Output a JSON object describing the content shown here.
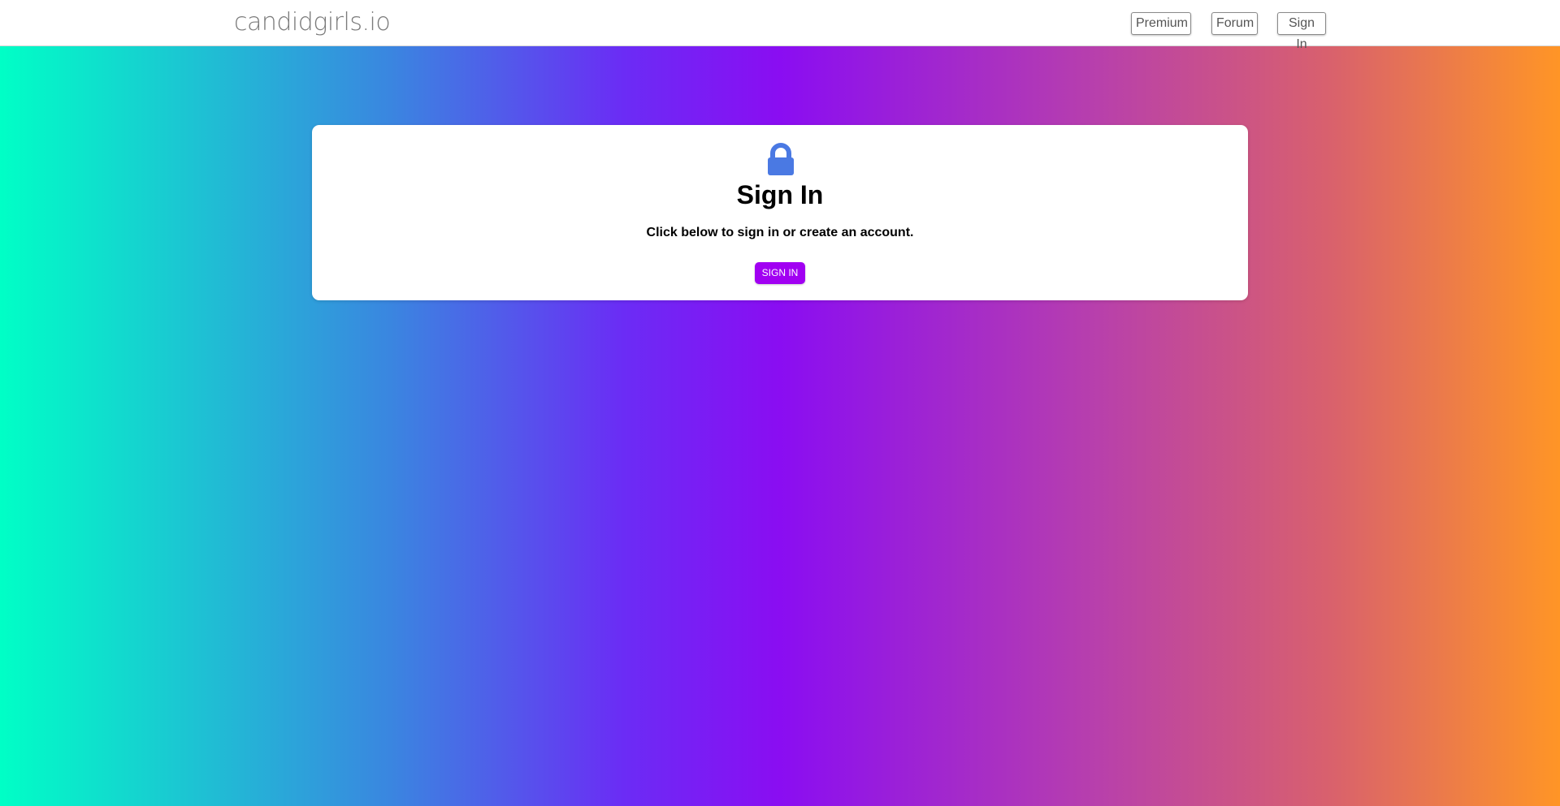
{
  "header": {
    "logo": "candidgirls.io",
    "nav": {
      "premium": "Premium",
      "forum": "Forum",
      "sign_in": "Sign In"
    }
  },
  "card": {
    "icon": "lock-icon",
    "title": "Sign In",
    "subtitle": "Click below to sign in or create an account.",
    "button_label": "SIGN IN"
  },
  "colors": {
    "accent": "#a100f2",
    "lock_icon": "#4a79e3",
    "gradient_stops": [
      "#00ffc6",
      "#3a86e0",
      "#6b2cf5",
      "#8a0df2",
      "#b73fad",
      "#d8606e",
      "#ff9526"
    ]
  }
}
